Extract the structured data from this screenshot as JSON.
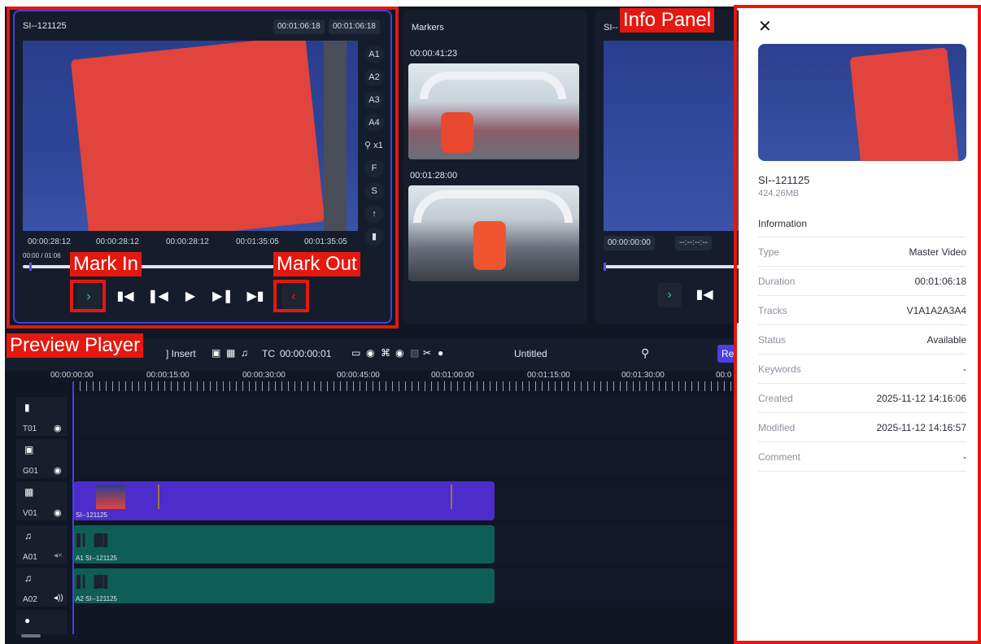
{
  "annotations": {
    "preview_player": "Preview Player",
    "mark_in": "Mark In",
    "mark_out": "Mark Out",
    "info_panel": "Info Panel"
  },
  "preview": {
    "clip_name": "SI--121125",
    "tc_pill_1": "00:01:06:18",
    "tc_pill_2": "00:01:06:18",
    "tracks": [
      "A1",
      "A2",
      "A3",
      "A4"
    ],
    "zoom": "x1",
    "side_letters": [
      "F",
      "S"
    ],
    "timecodes": [
      "00:00:28:12",
      "00:00:28:12",
      "00:00:28:12",
      "00:01:35:05",
      "00:01:35:05"
    ],
    "progress_text": "00:00 / 01:06",
    "progress": 0.02
  },
  "markers": {
    "title": "Markers",
    "items": [
      {
        "time": "00:00:41:23"
      },
      {
        "time": "00:01:28:00"
      }
    ]
  },
  "program": {
    "clip_name": "SI--",
    "tc_1": "00:00:00:00",
    "tc_2": "--:--:--:--"
  },
  "timeline_toolbar": {
    "insert_label": "Insert",
    "tc_label": "TC",
    "tc_value": "00:00:00:01",
    "project_name": "Untitled",
    "render_label": "Re"
  },
  "ruler": [
    "00:00:00:00",
    "00:00:15:00",
    "00:00:30:00",
    "00:00:45:00",
    "00:01:00:00",
    "00:01:15:00",
    "00:01:30:00",
    "00:0"
  ],
  "tracks": [
    {
      "name": "T01"
    },
    {
      "name": "G01"
    },
    {
      "name": "V01"
    },
    {
      "name": "A01"
    },
    {
      "name": "A02"
    }
  ],
  "clips": {
    "video_label": "SI--121125",
    "audio1_label": "A1 SI--121125",
    "audio2_label": "A2 SI--121125"
  },
  "info": {
    "close": "✕",
    "name": "SI--121125",
    "size": "424.26MB",
    "section": "Information",
    "rows": [
      {
        "key": "Type",
        "value": "Master Video"
      },
      {
        "key": "Duration",
        "value": "00:01:06:18"
      },
      {
        "key": "Tracks",
        "value": "V1A1A2A3A4"
      },
      {
        "key": "Status",
        "value": "Available"
      },
      {
        "key": "Keywords",
        "value": "-"
      },
      {
        "key": "Created",
        "value": "2025-11-12 14:16:06"
      },
      {
        "key": "Modified",
        "value": "2025-11-12 14:16:57"
      },
      {
        "key": "Comment",
        "value": "-"
      }
    ]
  }
}
